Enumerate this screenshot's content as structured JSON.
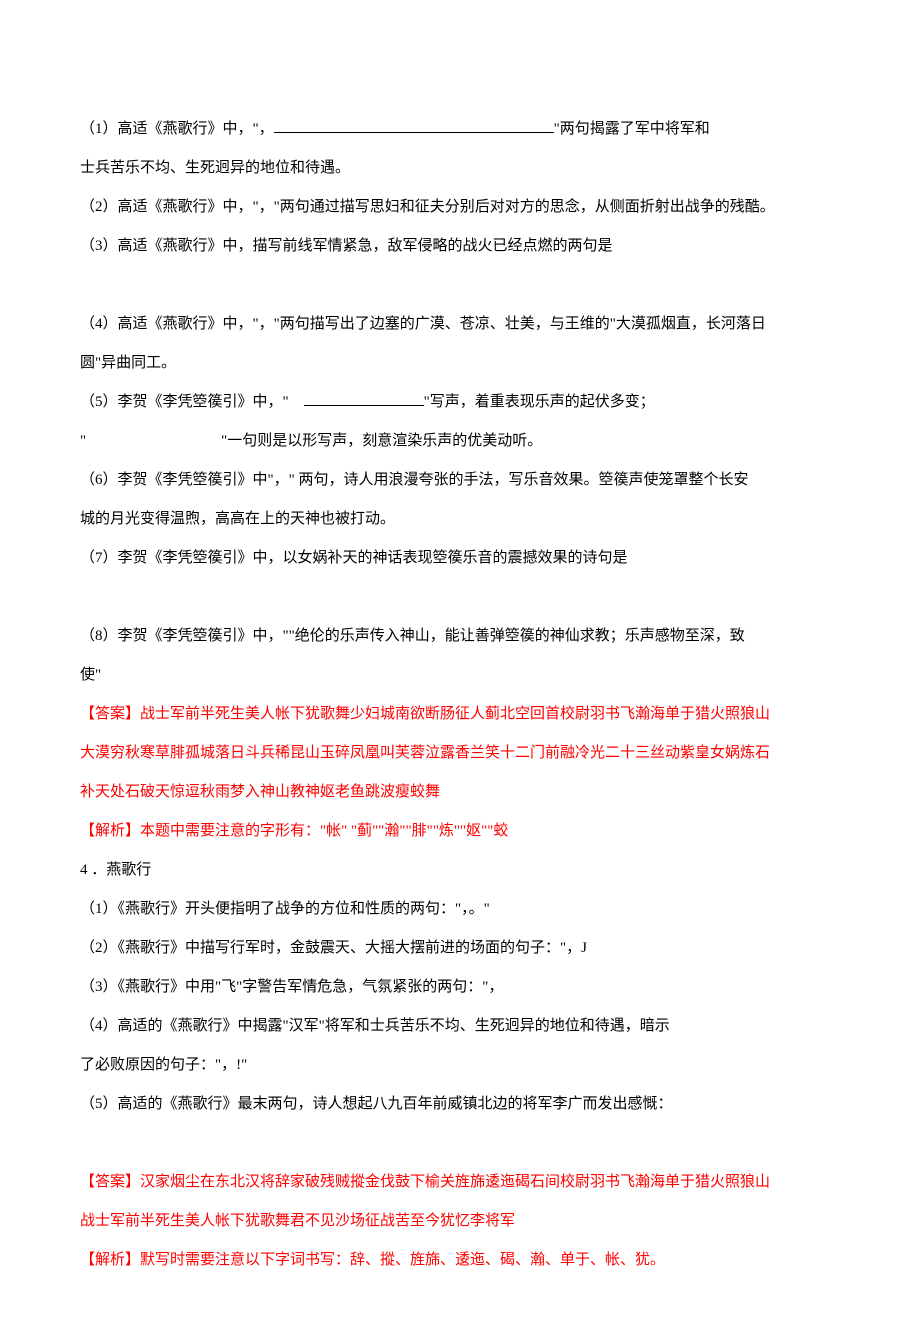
{
  "lines": [
    {
      "text": "（1）高适《燕歌行》中，\"，",
      "blank": "long",
      "tail": "\"两句揭露了军中将军和"
    },
    {
      "text": "士兵苦乐不均、生死迥异的地位和待遇。"
    },
    {
      "text": "（2）高适《燕歌行》中，\"，\"两句通过描写思妇和征夫分别后对对方的思念，从侧面折射出战争的残酷。"
    },
    {
      "text": "（3）高适《燕歌行》中，描写前线军情紧急，敌军侵略的战火已经点燃的两句是"
    },
    {
      "text": ""
    },
    {
      "text": "（4）高适《燕歌行》中，\"，\"两句描写出了边塞的广漠、苍凉、壮美，与王维的\"大漠孤烟直，长河落日"
    },
    {
      "text": "圆\"异曲同工。"
    },
    {
      "text": "（5）李贺《李凭箜篌引》中，\"　",
      "blank": "short",
      "tail": "\"写声，着重表现乐声的起伏多变；"
    },
    {
      "text": "\"　　　　　　　　　\"一句则是以形写声，刻意渲染乐声的优美动听。"
    },
    {
      "text": "（6）李贺《李凭箜篌引》中\"，\" 两句，诗人用浪漫夸张的手法，写乐音效果。箜篌声使笼罩整个长安"
    },
    {
      "text": "城的月光变得温煦，高高在上的天神也被打动。"
    },
    {
      "text": "（7）李贺《李凭箜篌引》中，以女娲补天的神话表现箜篌乐音的震撼效果的诗句是"
    },
    {
      "text": ""
    },
    {
      "text": "（8）李贺《李凭箜篌引》中，\"\"绝伦的乐声传入神山，能让善弹箜篌的神仙求教；乐声感物至深，致"
    },
    {
      "text": "使\""
    },
    {
      "text": "【答案】战士军前半死生美人帐下犹歌舞少妇城南欲断肠征人蓟北空回首校尉羽书飞瀚海单于猎火照狼山",
      "color": "red"
    },
    {
      "text": "大漠穷秋寒草腓孤城落日斗兵稀昆山玉碎凤凰叫芙蓉泣露香兰笑十二门前融冷光二十三丝动紫皇女娲炼石",
      "color": "red"
    },
    {
      "text": "补天处石破天惊逗秋雨梦入神山教神妪老鱼跳波瘦蛟舞",
      "color": "red"
    },
    {
      "text": "【解析】本题中需要注意的字形有：\"帐\" \"蓟\"\"瀚\"\"腓\"\"炼\"\"妪\"\"蛟",
      "color": "red"
    },
    {
      "text": "4 ．燕歌行"
    },
    {
      "text": "（1）《燕歌行》开头便指明了战争的方位和性质的两句：\"，。\""
    },
    {
      "text": "（2）《燕歌行》中描写行军时，金鼓震天、大摇大摆前进的场面的句子：\"，J"
    },
    {
      "text": "（3）《燕歌行》中用\"飞\"字警告军情危急，气氛紧张的两句：\"，"
    },
    {
      "text": "（4）高适的《燕歌行》中揭露\"汉军\"将军和士兵苦乐不均、生死迥异的地位和待遇，暗示"
    },
    {
      "text": "了必败原因的句子：\"，!\""
    },
    {
      "text": "（5）高适的《燕歌行》最末两句，诗人想起八九百年前威镇北边的将军李广而发出感慨："
    },
    {
      "text": ""
    },
    {
      "text": "【答案】汉家烟尘在东北汉将辞家破残贼摐金伐鼓下榆关旌旆逶迤碣石间校尉羽书飞瀚海单于猎火照狼山",
      "color": "red"
    },
    {
      "text": "战士军前半死生美人帐下犹歌舞君不见沙场征战苦至今犹忆李将军",
      "color": "red"
    },
    {
      "text": "【解析】默写时需要注意以下字词书写：辞、摐、旌旆、逶迤、碣、瀚、单于、帐、犹。",
      "color": "red"
    }
  ]
}
